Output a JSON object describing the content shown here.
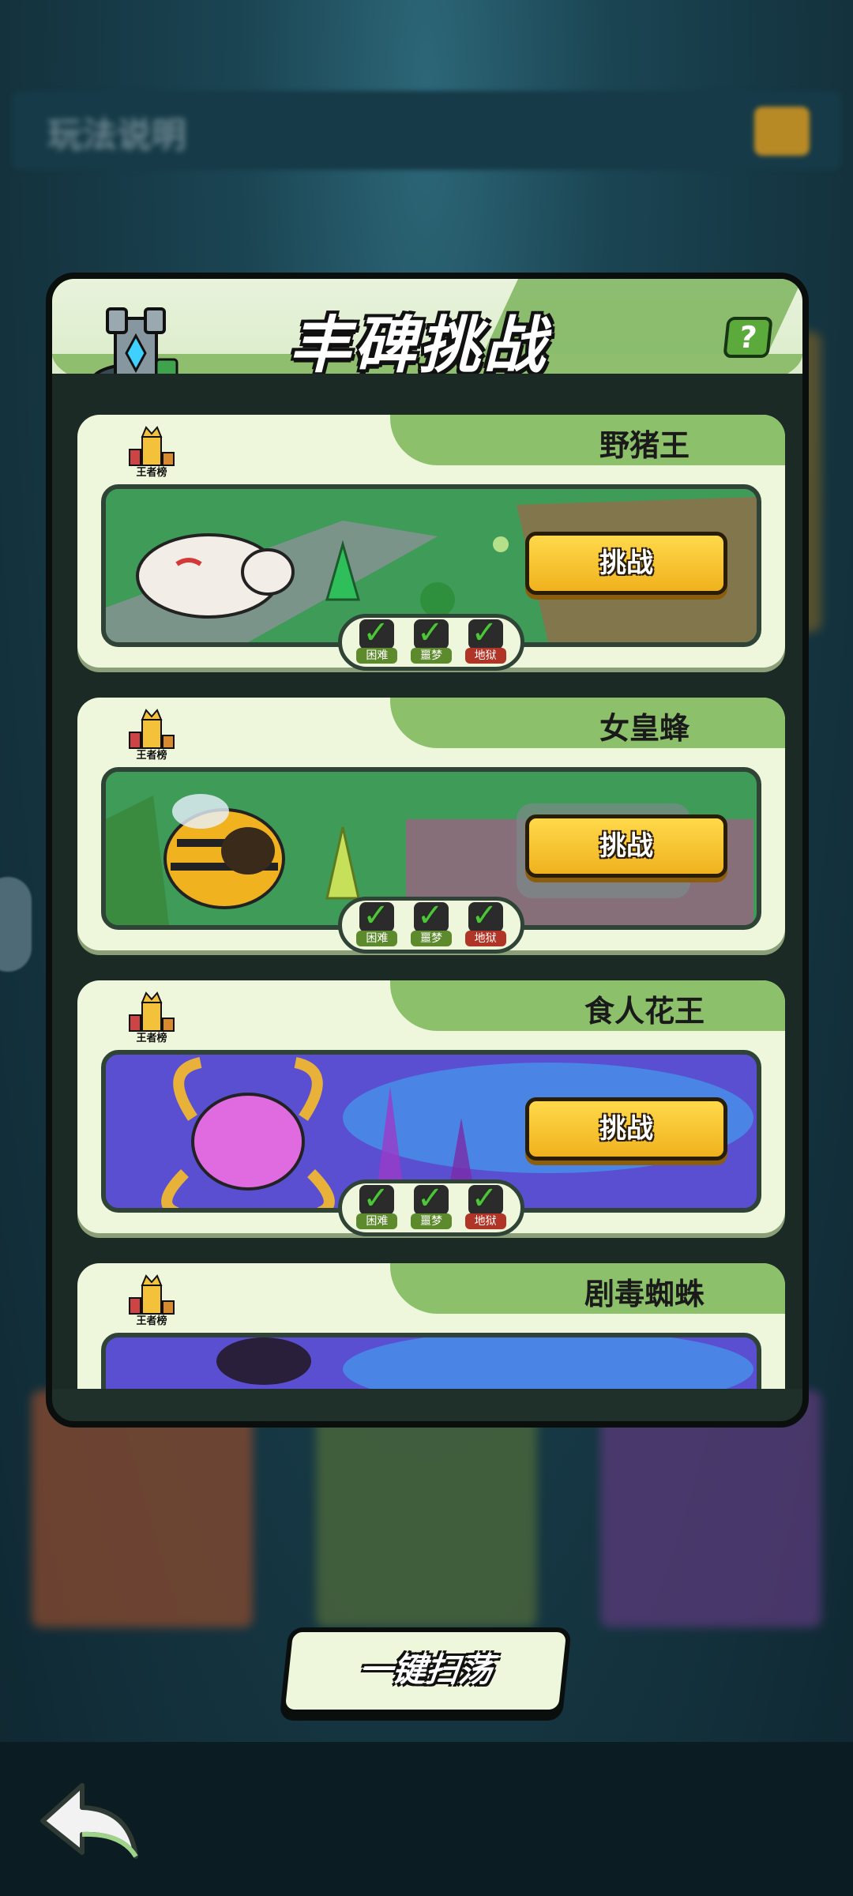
{
  "background": {
    "top_title": "玩法说明"
  },
  "panel": {
    "title": "丰碑挑战",
    "help_label": "?"
  },
  "bosses": [
    {
      "name": "野猪王",
      "badge_label": "王者榜",
      "challenge_label": "挑战",
      "difficulties": [
        {
          "label": "困难",
          "cleared": true
        },
        {
          "label": "噩梦",
          "cleared": true
        },
        {
          "label": "地狱",
          "cleared": true
        }
      ]
    },
    {
      "name": "女皇蜂",
      "badge_label": "王者榜",
      "challenge_label": "挑战",
      "difficulties": [
        {
          "label": "困难",
          "cleared": true
        },
        {
          "label": "噩梦",
          "cleared": true
        },
        {
          "label": "地狱",
          "cleared": true
        }
      ]
    },
    {
      "name": "食人花王",
      "badge_label": "王者榜",
      "challenge_label": "挑战",
      "difficulties": [
        {
          "label": "困难",
          "cleared": true
        },
        {
          "label": "噩梦",
          "cleared": true
        },
        {
          "label": "地狱",
          "cleared": true
        }
      ]
    },
    {
      "name": "剧毒蜘蛛",
      "badge_label": "王者榜"
    }
  ],
  "sweep_button": {
    "label": "一键扫荡"
  },
  "icons": {
    "back": "back-arrow-icon",
    "help": "question-icon",
    "tower": "monument-tower-icon",
    "badge": "crown-rank-badge-icon",
    "check": "checkmark-icon"
  },
  "colors": {
    "accent_green": "#8cc06b",
    "button_yellow": "#f0b21e",
    "check_green": "#4ec43a"
  }
}
